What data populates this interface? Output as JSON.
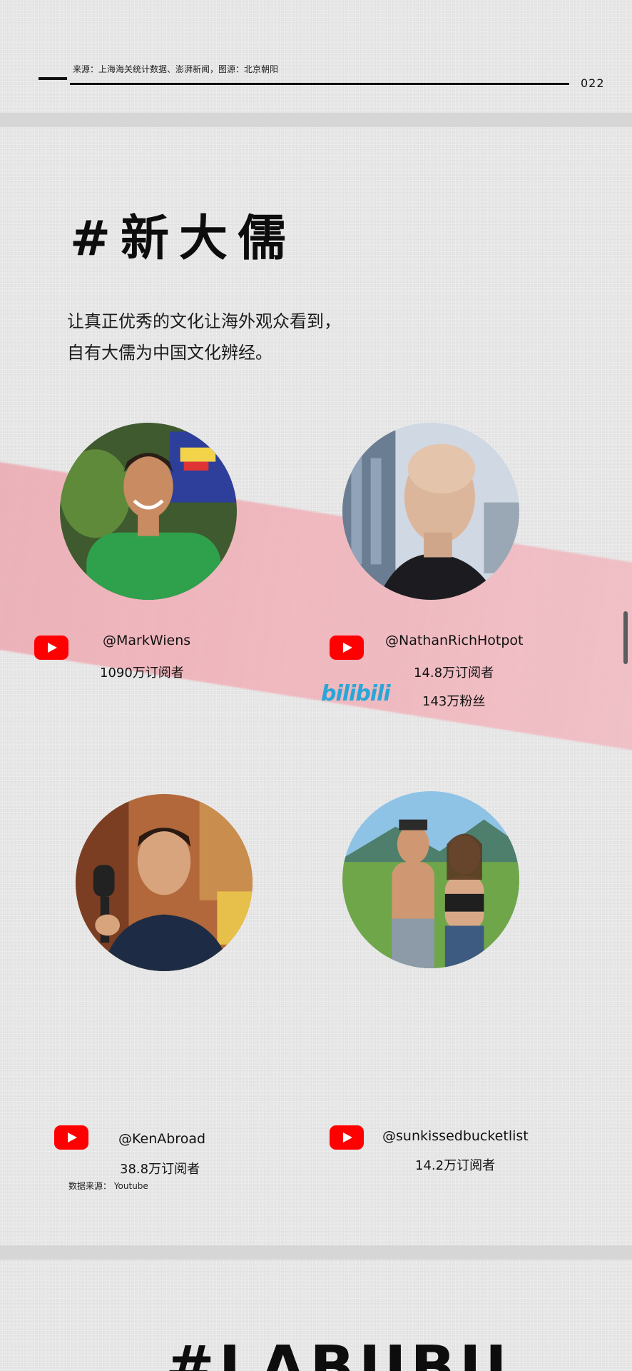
{
  "header": {
    "source_note": "来源：上海海关统计数据、澎湃新闻，图源：北京朝阳",
    "page_number": "022"
  },
  "section": {
    "title": "#新大儒",
    "subtitle_lines": [
      "让真正优秀的文化让海外观众看到，",
      "自有大儒为中国文化辨经。"
    ]
  },
  "creators": [
    {
      "handle": "@MarkWiens",
      "platform_icon": "youtube-icon",
      "stats": [
        "1090万订阅者"
      ]
    },
    {
      "handle": "@NathanRichHotpot",
      "platform_icon": "youtube-icon",
      "stats": [
        "14.8万订阅者"
      ],
      "secondary_platform": {
        "label": "bilibili",
        "stat": "143万粉丝"
      }
    },
    {
      "handle": "@KenAbroad",
      "platform_icon": "youtube-icon",
      "stats": [
        "38.8万订阅者"
      ]
    },
    {
      "handle": "@sunkissedbucketlist",
      "platform_icon": "youtube-icon",
      "stats": [
        "14.2万订阅者"
      ]
    }
  ],
  "data_source": "数据来源：  Youtube",
  "next_section": {
    "title": "#LABUBU"
  },
  "colors": {
    "youtube_red": "#ff0000",
    "bilibili_blue": "#2aa6d6",
    "accent_stripe": "#eaa2aa"
  }
}
